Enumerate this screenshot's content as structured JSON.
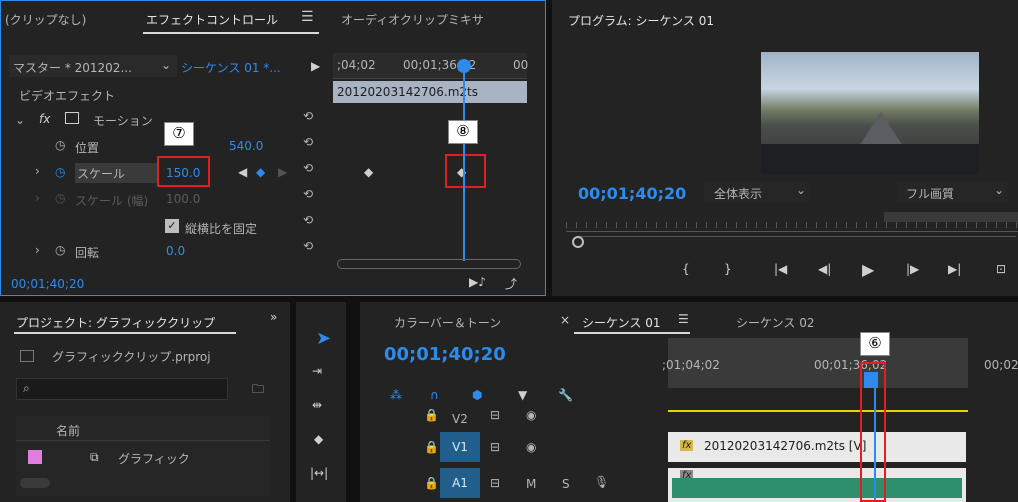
{
  "effect_panel": {
    "tab_prev": "(クリップなし)",
    "tab_active": "エフェクトコントロール",
    "tab_next": "オーディオクリップミキサ",
    "source_master": "マスター * 201202...",
    "source_sequence": "シーケンス 01 *...",
    "section_video_effect": "ビデオエフェクト",
    "fx_label": "fx",
    "motion_label": "モーション",
    "position_label": "位置",
    "position_value": "540.0",
    "scale_label": "スケール",
    "scale_value": "150.0",
    "scale_width_label": "スケール (幅)",
    "scale_width_value": "100.0",
    "uniform_scale_label": "縦横比を固定",
    "rotation_label": "回転",
    "rotation_value": "0.0",
    "timecode": "00;01;40;20",
    "ruler_left": ";04;02",
    "ruler_mid": "00;01;36;02",
    "ruler_right": "00",
    "clip_name": "20120203142706.m2ts"
  },
  "program_monitor": {
    "title": "プログラム: シーケンス 01",
    "timecode": "00;01;40;20",
    "zoom_select": "全体表示",
    "quality_select": "フル画質"
  },
  "project_panel": {
    "title": "プロジェクト: グラフィッククリップ",
    "project_file": "グラフィッククリップ.prproj",
    "column_name": "名前",
    "item_name": "グラフィック",
    "item_color": "#e27de0"
  },
  "timeline": {
    "tab_colorbars": "カラーバー＆トーン",
    "tab_seq01": "シーケンス 01",
    "tab_seq02": "シーケンス 02",
    "timecode": "00;01;40;20",
    "ruler_left": ";01;04;02",
    "ruler_mid": "00;01;36;02",
    "ruler_right": "00;02",
    "track_v2": "V2",
    "track_v1": "V1",
    "track_a1": "A1",
    "m_label": "M",
    "s_label": "S",
    "clip_v1": "20120203142706.m2ts [V]",
    "clip_fx": "fx"
  },
  "callouts": {
    "c6": "⑥",
    "c7": "⑦",
    "c8": "⑧"
  },
  "colors": {
    "accent_blue": "#2d8ceb",
    "red_highlight": "#e02020",
    "audio_green": "#2e8f6e",
    "track_yellow": "#e7d200"
  }
}
